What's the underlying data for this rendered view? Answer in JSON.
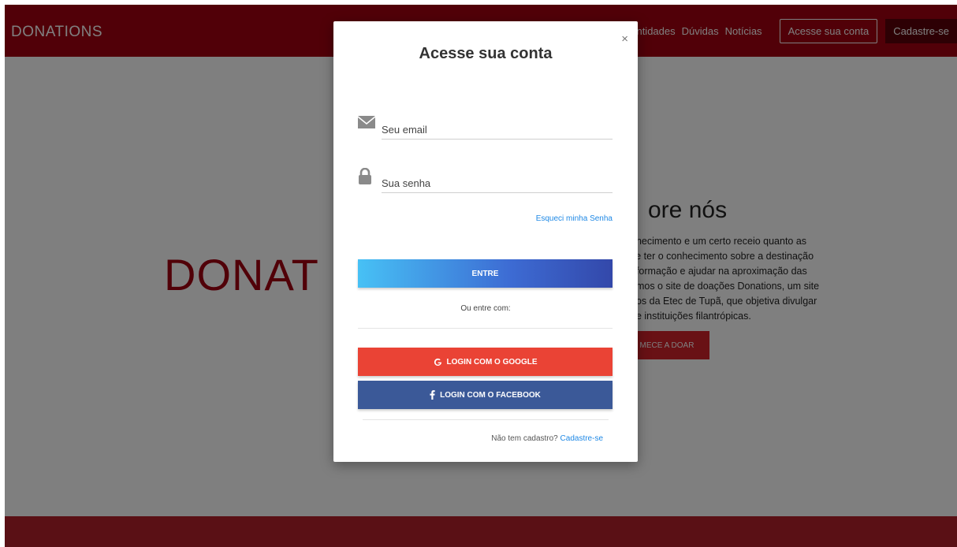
{
  "navbar": {
    "brand": "DONATIONS",
    "links": [
      "Entidades",
      "Dúvidas",
      "Notícias"
    ],
    "login_label": "Acesse sua conta",
    "signup_label": "Cadastre-se"
  },
  "hero": {
    "logo_text": "DONAT",
    "about_title": "ore nós",
    "about_lines": [
      "nhecimento e um certo receio quanto as",
      "se ter o conhecimento sobre a destinação",
      "nformação e ajudar na aproximação das",
      "amos o site de doações Donations, um site",
      "nos da Etec de Tupã, que objetiva divulgar",
      "de instituições filantrópicas."
    ],
    "cta_label": "MECE A DOAR"
  },
  "modal": {
    "close": "×",
    "title": "Acesse sua conta",
    "email_placeholder": "Seu email",
    "password_placeholder": "Sua senha",
    "forgot_label": "Esqueci minha Senha",
    "enter_label": "ENTRE",
    "or_text": "Ou entre com:",
    "google_label": "LOGIN COM O GOOGLE",
    "facebook_label": "LOGIN COM O FACEBOOK",
    "signup_prompt": "Não tem cadastro?",
    "signup_link": "Cadastre-se"
  },
  "icons": {
    "email": "envelope-icon",
    "password": "lock-icon",
    "google": "google-icon",
    "facebook": "facebook-icon",
    "close": "close-icon"
  },
  "colors": {
    "brand_red": "#a30010",
    "google": "#ea4335",
    "facebook": "#3b5998",
    "link_blue": "#1e88e5"
  }
}
